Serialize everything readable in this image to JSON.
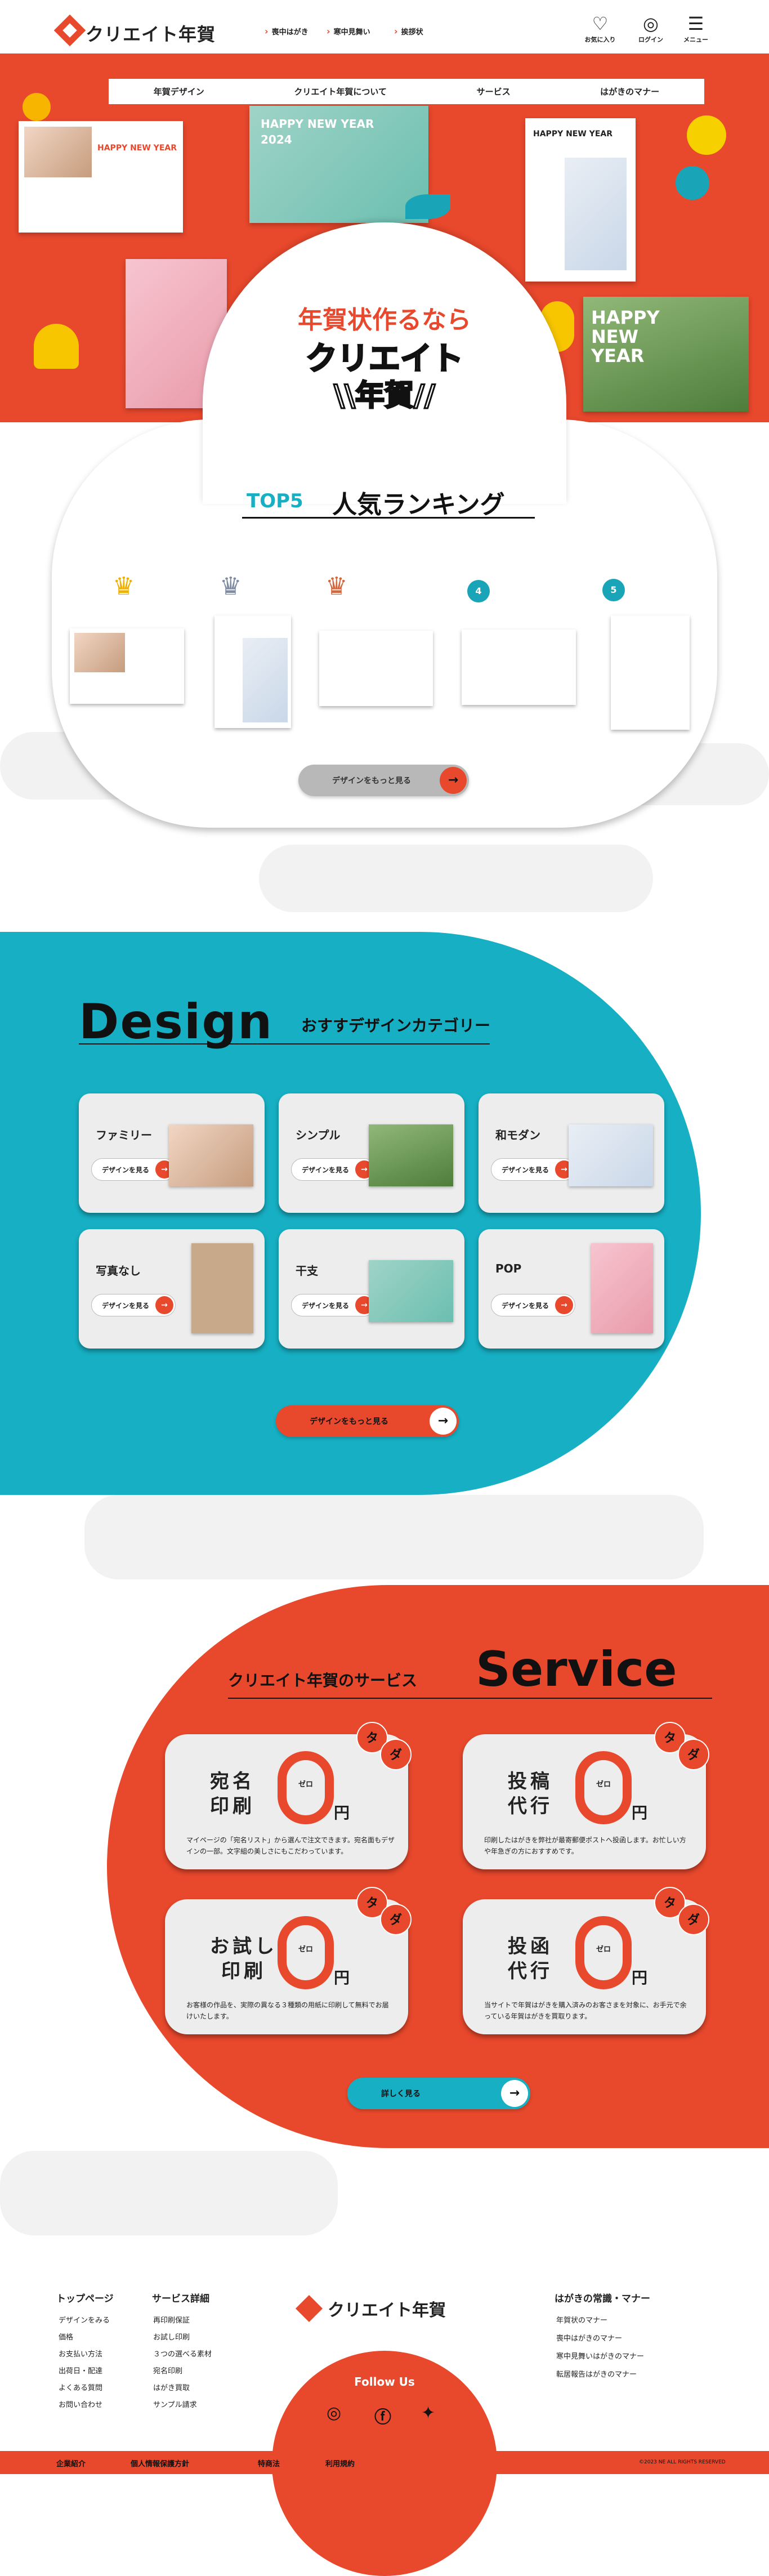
{
  "header": {
    "logo": "クリエイト年賀",
    "nav": [
      "喪中はがき",
      "寒中見舞い",
      "挨拶状"
    ],
    "icons": [
      {
        "name": "heart-icon",
        "label": "お気に入り",
        "glyph": "♡"
      },
      {
        "name": "user-icon",
        "label": "ログイン",
        "glyph": "◎"
      },
      {
        "name": "menu-icon",
        "label": "メニュー",
        "glyph": "☰"
      }
    ]
  },
  "subnav": [
    "年賀デザイン",
    "クリエイト年賀について",
    "サービス",
    "はがきのマナー"
  ],
  "hero": {
    "card_text": "HAPPY NEW YEAR",
    "card_year": "2024",
    "catch_line1": "年賀状作るなら",
    "catch_line2": "クリエイト",
    "catch_line3": "\\\\年賀//"
  },
  "ranking": {
    "top": "TOP5",
    "title": "人気ランキング",
    "ranks": [
      "♛",
      "♛",
      "♛",
      "4",
      "5"
    ],
    "crown_colors": [
      "#f0b000",
      "#7f8aa3",
      "#d5663c"
    ],
    "button": "デザインをもっと見る"
  },
  "design": {
    "heading": "Design",
    "subheading": "おすすデザインカテゴリー",
    "categories": [
      "ファミリー",
      "シンプル",
      "和モダン",
      "写真なし",
      "干支",
      "POP"
    ],
    "category_button": "デザインを見る",
    "button": "デザインをもっと見る"
  },
  "service": {
    "heading": "Service",
    "subheading": "クリエイト年賀のサービス",
    "tada": [
      "タ",
      "ダ"
    ],
    "zero_label": "ゼロ",
    "yen": "円",
    "items": [
      {
        "title1": "宛名",
        "title2": "印刷",
        "desc": "マイページの「宛名リスト」から選んで注文できます。宛名面もデザインの一部。文字組の美しさにもこだわっています。"
      },
      {
        "title1": "投稿",
        "title2": "代行",
        "desc": "印刷したはがきを弊社が最寄郵便ポストへ投函します。お忙しい方や年急ぎの方におすすめです。"
      },
      {
        "title1": "お試し",
        "title2": "印刷",
        "desc": "お客様の作品を、実際の異なる３種類の用紙に印刷して無料でお届けいたします。"
      },
      {
        "title1": "投函",
        "title2": "代行",
        "desc": "当サイトで年賀はがきを購入済みのお客さまを対象に、お手元で余っている年賀はがきを買取ります。"
      }
    ],
    "button": "詳しく見る"
  },
  "footer": {
    "col1_title": "トップページ",
    "col1_links": [
      "デザインをみる",
      "価格",
      "お支払い方法",
      "出荷日・配達",
      "よくある質問",
      "お問い合わせ"
    ],
    "col2_title": "サービス詳細",
    "col2_links": [
      "再印刷保証",
      "お試し印刷",
      "３つの選べる素材",
      "宛名印刷",
      "はがき買取",
      "サンプル請求"
    ],
    "col3_title": "はがきの常識・マナー",
    "col3_links": [
      "年賀状のマナー",
      "喪中はがきのマナー",
      "寒中見舞いはがきのマナー",
      "転居報告はがきのマナー"
    ],
    "logo": "クリエイト年賀",
    "follow": "Follow Us",
    "bottom_links": [
      "企業紹介",
      "個人情報保護方針",
      "特商法",
      "利用規約"
    ],
    "copyright": "©2023 NE ALL RIGHTS RESERVED"
  },
  "colors": {
    "accent": "#e8482c",
    "teal": "#16afc3"
  }
}
